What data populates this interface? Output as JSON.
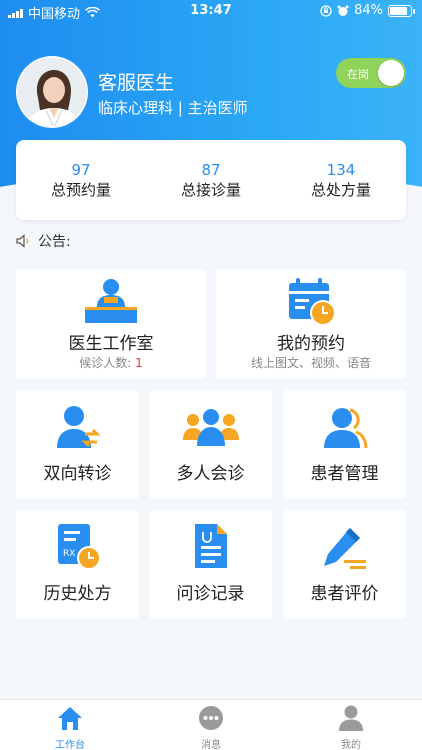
{
  "status_bar": {
    "carrier": "中国移动",
    "time": "13:47",
    "battery": "84%"
  },
  "profile": {
    "name": "客服医生",
    "title": "临床心理科 | 主治医师"
  },
  "duty_toggle": {
    "label": "在岗"
  },
  "stats": [
    {
      "value": "97",
      "label": "总预约量"
    },
    {
      "value": "87",
      "label": "总接诊量"
    },
    {
      "value": "134",
      "label": "总处方量"
    }
  ],
  "notice": {
    "label": "公告:"
  },
  "cards": {
    "studio": {
      "title": "医生工作室",
      "sub_label": "候诊人数:",
      "sub_value": "1"
    },
    "appointment": {
      "title": "我的预约",
      "sub": "线上图文、视频、语音"
    },
    "referral": {
      "title": "双向转诊"
    },
    "consultation": {
      "title": "多人会诊"
    },
    "patients": {
      "title": "患者管理"
    },
    "prescriptions": {
      "title": "历史处方"
    },
    "records": {
      "title": "问诊记录"
    },
    "reviews": {
      "title": "患者评价"
    }
  },
  "tabbar": [
    {
      "label": "工作台",
      "icon": "home-icon"
    },
    {
      "label": "消息",
      "icon": "chat-icon"
    },
    {
      "label": "我的",
      "icon": "user-icon"
    }
  ],
  "colors": {
    "primary": "#2a8ef0",
    "accent_orange": "#f5a623",
    "toggle_green": "#8fd35a",
    "alert_red": "#e23b2f"
  }
}
